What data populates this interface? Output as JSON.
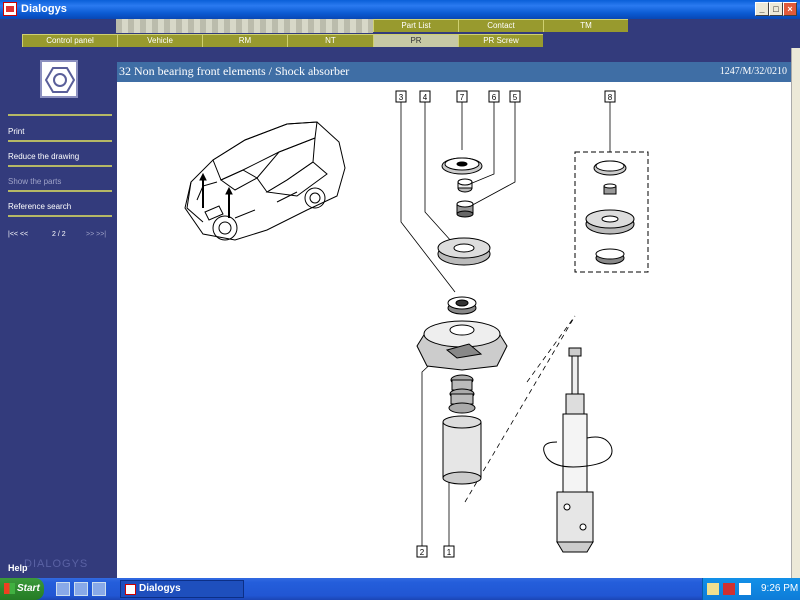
{
  "window": {
    "title": "Dialogys",
    "buttons": {
      "minimize": "_",
      "maximize": "□",
      "close": "×"
    }
  },
  "menu": {
    "top_row": [
      "Part List",
      "Contact",
      "TM"
    ],
    "bottom_row": [
      "Control panel",
      "Vehicle",
      "RM",
      "NT",
      "PR",
      "PR Screw"
    ],
    "active": "PR"
  },
  "sidebar": {
    "logo_icon": "hex-nut-icon",
    "items": [
      {
        "label": "Print",
        "enabled": true
      },
      {
        "label": "Reduce the drawing",
        "enabled": true
      },
      {
        "label": "Show the parts",
        "enabled": false
      },
      {
        "label": "Reference search",
        "enabled": true
      }
    ],
    "pager": {
      "first_prev": "|<< <<",
      "page": "2 / 2",
      "next_last": ">> >>|"
    },
    "brand": "DIALOGYS",
    "help": "Help"
  },
  "content": {
    "title": "32 Non bearing front elements / Shock absorber",
    "code": "1247/M/32/0210",
    "callouts": [
      "3",
      "4",
      "7",
      "6",
      "5",
      "8",
      "2",
      "1"
    ]
  },
  "taskbar": {
    "start_label": "Start",
    "task_label": "Dialogys",
    "clock": "9:26 PM"
  },
  "colors": {
    "panel": "#333b7c",
    "menu_button": "#989a2e",
    "menu_button_active": "#c7c9a5",
    "header": "#3f6ea5",
    "separator": "#b6b865"
  }
}
